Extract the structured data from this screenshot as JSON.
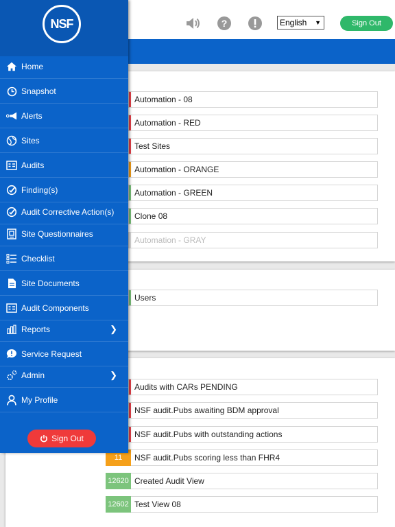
{
  "header": {
    "language": "English",
    "sign_out": "Sign Out"
  },
  "sidebar": {
    "logo_text": "NSF",
    "items": [
      {
        "label": "Home",
        "icon": "home-icon"
      },
      {
        "label": "Snapshot",
        "icon": "clock-icon"
      },
      {
        "label": "Alerts",
        "icon": "megaphone-icon"
      },
      {
        "label": "Sites",
        "icon": "globe-icon"
      },
      {
        "label": "Audits",
        "icon": "audit-icon"
      },
      {
        "label": "Finding(s)",
        "icon": "finding-icon"
      },
      {
        "label": "Audit Corrective Action(s)",
        "icon": "corrective-icon"
      },
      {
        "label": "Site Questionnaires",
        "icon": "questionnaire-icon"
      },
      {
        "label": "Checklist",
        "icon": "checklist-icon"
      },
      {
        "label": "Site Documents",
        "icon": "document-icon"
      },
      {
        "label": "Audit Components",
        "icon": "components-icon"
      },
      {
        "label": "Reports",
        "icon": "chart-icon",
        "chevron": true
      },
      {
        "label": "Service Request",
        "icon": "chat-icon"
      },
      {
        "label": "Admin",
        "icon": "gear-icon",
        "chevron": true
      },
      {
        "label": "My Profile",
        "icon": "user-icon"
      }
    ],
    "sign_out": "Sign Out"
  },
  "panel1": {
    "rows": [
      {
        "label": "Automation - 08",
        "color": "#e8434b"
      },
      {
        "label": "Automation - RED",
        "color": "#e8434b"
      },
      {
        "label": "Test Sites",
        "color": "#e8434b"
      },
      {
        "label": "Automation - ORANGE",
        "color": "#f5a01a"
      },
      {
        "label": "Automation - GREEN",
        "color": "#7cc47c"
      },
      {
        "label": "Clone 08",
        "color": "#7cc47c"
      },
      {
        "label": "Automation - GRAY",
        "color": "#dddddd"
      }
    ]
  },
  "panel2": {
    "rows": [
      {
        "label": "Users",
        "color": "#7cc47c"
      }
    ]
  },
  "panel3": {
    "rows": [
      {
        "label": "Audits with CARs PENDING",
        "color": "#e8434b",
        "badge": ""
      },
      {
        "label": "NSF audit.Pubs awaiting BDM approval",
        "color": "#e8434b",
        "badge": ""
      },
      {
        "label": "NSF audit.Pubs with outstanding actions",
        "color": "#e8434b",
        "badge": ""
      },
      {
        "label": "NSF audit.Pubs scoring less than FHR4",
        "color": "#f5a01a",
        "badge": "11"
      },
      {
        "label": "Created Audit View",
        "color": "#7cc47c",
        "badge": "12620"
      },
      {
        "label": "Test View 08",
        "color": "#7cc47c",
        "badge": "12602"
      }
    ]
  },
  "colors": {
    "primary": "#0b63c9",
    "signout_green": "#2fb86a",
    "signout_red": "#ef3a3a",
    "alert_red": "#e8434b",
    "warning_orange": "#f5a01a",
    "ok_green": "#7cc47c"
  }
}
